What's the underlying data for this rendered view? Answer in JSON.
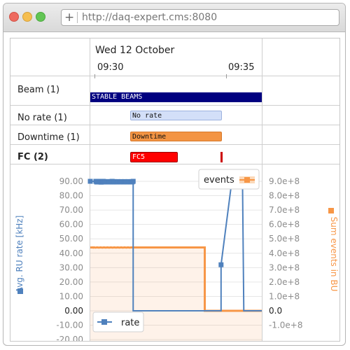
{
  "browser": {
    "url": "http://daq-expert.cms:8080",
    "new_tab_symbol": "+"
  },
  "timeline": {
    "date": "Wed 12 October",
    "ticks": [
      "09:30",
      "09:35"
    ]
  },
  "rows": [
    {
      "label": "Beam (1)",
      "bold": false,
      "bar_text": "STABLE BEAMS"
    },
    {
      "label": "No rate (1)",
      "bold": false,
      "bar_text": "No rate"
    },
    {
      "label": "Downtime (1)",
      "bold": false,
      "bar_text": "Downtime"
    },
    {
      "label": "FC (2)",
      "bold": true,
      "bar_text": "FC5"
    }
  ],
  "colors": {
    "beam": "#000080",
    "norate": "#d3dff8",
    "downtime": "#f39443",
    "fc": "#ff0000",
    "rate_series": "#4f81bd",
    "events_series": "#f79646"
  },
  "chart_data": {
    "type": "line",
    "y_left": {
      "label": "Avg. RU rate [kHz]",
      "ticks": [
        "90.00",
        "80.00",
        "70.00",
        "60.00",
        "50.00",
        "40.00",
        "30.00",
        "20.00",
        "10.00",
        "0.00",
        "-10.00",
        "-20.00"
      ]
    },
    "y_right": {
      "label": "Sum events in BU",
      "ticks": [
        "9.0e+8",
        "8.0e+8",
        "7.0e+8",
        "6.0e+8",
        "5.0e+8",
        "4.0e+8",
        "3.0e+8",
        "2.0e+8",
        "1.0e+8",
        "0.0",
        "-1.0e+8"
      ]
    },
    "series": [
      {
        "name": "rate",
        "axis": "left",
        "points": [
          [
            0,
            90
          ],
          [
            0.13,
            90
          ],
          [
            0.14,
            90
          ],
          [
            0.15,
            89.5
          ],
          [
            0.16,
            89.8
          ],
          [
            0.17,
            89.6
          ],
          [
            0.18,
            89.7
          ],
          [
            0.2,
            89.5
          ],
          [
            0.22,
            89.8
          ],
          [
            0.23,
            89.6
          ],
          [
            0.24,
            90
          ],
          [
            0.25,
            89.4
          ],
          [
            0.26,
            89.7
          ],
          [
            0.27,
            89.5
          ],
          [
            0.28,
            89.8
          ],
          [
            0.29,
            89.6
          ],
          [
            0.3,
            90
          ],
          [
            0.31,
            89.5
          ],
          [
            0.32,
            89.8
          ],
          [
            0.33,
            89.6
          ],
          [
            0.34,
            89.8
          ],
          [
            0.35,
            89.5
          ],
          [
            0.36,
            89.7
          ],
          [
            0.38,
            89.6
          ],
          [
            0.4,
            89.8
          ],
          [
            0.42,
            89.5
          ],
          [
            0.44,
            89.7
          ],
          [
            0.45,
            89.6
          ],
          [
            0.46,
            89.8
          ],
          [
            0.47,
            89.5
          ],
          [
            0.48,
            89.7
          ],
          [
            0.49,
            89.6
          ],
          [
            0.5,
            89.8
          ],
          [
            0.51,
            90
          ],
          [
            0.52,
            89.5
          ],
          [
            0.53,
            89.8
          ],
          [
            0.54,
            89.6
          ],
          [
            0.55,
            89.7
          ],
          [
            0.56,
            89.5
          ],
          [
            0.57,
            89.8
          ],
          [
            0.58,
            89.6
          ],
          [
            0.6,
            89.7
          ],
          [
            0.62,
            89.5
          ],
          [
            0.64,
            89.8
          ],
          [
            0.66,
            89.6
          ],
          [
            0.68,
            89.7
          ],
          [
            0.7,
            89.5
          ],
          [
            0.72,
            89.8
          ],
          [
            0.74,
            89.6
          ],
          [
            0.76,
            89.7
          ],
          [
            0.78,
            89.5
          ],
          [
            0.8,
            89.8
          ],
          [
            0.82,
            89.6
          ],
          [
            0.84,
            89.7
          ],
          [
            0.86,
            89.5
          ],
          [
            0.88,
            89.8
          ],
          [
            0.9,
            89.6
          ],
          [
            0.92,
            89.7
          ],
          [
            0.94,
            89.5
          ],
          [
            0.96,
            89.8
          ],
          [
            0.98,
            89.6
          ],
          [
            1,
            90
          ],
          [
            1,
            0
          ],
          [
            3.05,
            0
          ],
          [
            3.05,
            32
          ],
          [
            3.3,
            90
          ],
          [
            3.4,
            90
          ],
          [
            3.5,
            90
          ],
          [
            3.55,
            90
          ],
          [
            3.58,
            0
          ],
          [
            4,
            0
          ]
        ]
      },
      {
        "name": "events",
        "axis": "right",
        "points": [
          [
            0,
            440000000
          ],
          [
            0.05,
            440000000
          ],
          [
            0.06,
            441000000
          ],
          [
            0.07,
            439000000
          ],
          [
            0.08,
            440000000
          ],
          [
            0.09,
            441000000
          ],
          [
            0.1,
            440000000
          ],
          [
            0.12,
            439000000
          ],
          [
            0.14,
            440000000
          ],
          [
            0.16,
            441000000
          ],
          [
            0.18,
            440000000
          ],
          [
            0.2,
            439000000
          ],
          [
            0.22,
            440000000
          ],
          [
            0.24,
            441000000
          ],
          [
            0.26,
            440000000
          ],
          [
            0.28,
            439000000
          ],
          [
            0.3,
            440000000
          ],
          [
            0.32,
            441000000
          ],
          [
            0.34,
            440000000
          ],
          [
            0.36,
            439000000
          ],
          [
            0.38,
            440000000
          ],
          [
            0.4,
            441000000
          ],
          [
            0.42,
            440000000
          ],
          [
            0.44,
            439000000
          ],
          [
            0.46,
            440000000
          ],
          [
            0.48,
            441000000
          ],
          [
            0.5,
            440000000
          ],
          [
            0.52,
            439000000
          ],
          [
            0.54,
            440000000
          ],
          [
            0.56,
            441000000
          ],
          [
            0.58,
            440000000
          ],
          [
            0.6,
            439000000
          ],
          [
            0.62,
            440000000
          ],
          [
            0.64,
            441000000
          ],
          [
            0.66,
            440000000
          ],
          [
            0.68,
            439000000
          ],
          [
            0.7,
            440000000
          ],
          [
            0.72,
            441000000
          ],
          [
            0.74,
            440000000
          ],
          [
            0.76,
            439000000
          ],
          [
            0.78,
            440000000
          ],
          [
            0.8,
            441000000
          ],
          [
            0.82,
            440000000
          ],
          [
            0.84,
            439000000
          ],
          [
            0.86,
            440000000
          ],
          [
            0.88,
            441000000
          ],
          [
            0.9,
            440000000
          ],
          [
            0.92,
            439000000
          ],
          [
            0.94,
            440000000
          ],
          [
            0.96,
            441000000
          ],
          [
            0.98,
            440000000
          ],
          [
            1,
            440000000
          ],
          [
            1,
            440000000
          ],
          [
            2.67,
            440000000
          ],
          [
            2.67,
            0
          ],
          [
            4,
            0
          ]
        ]
      }
    ],
    "legend_top": {
      "name": "events"
    },
    "legend_bottom": {
      "name": "rate"
    }
  }
}
